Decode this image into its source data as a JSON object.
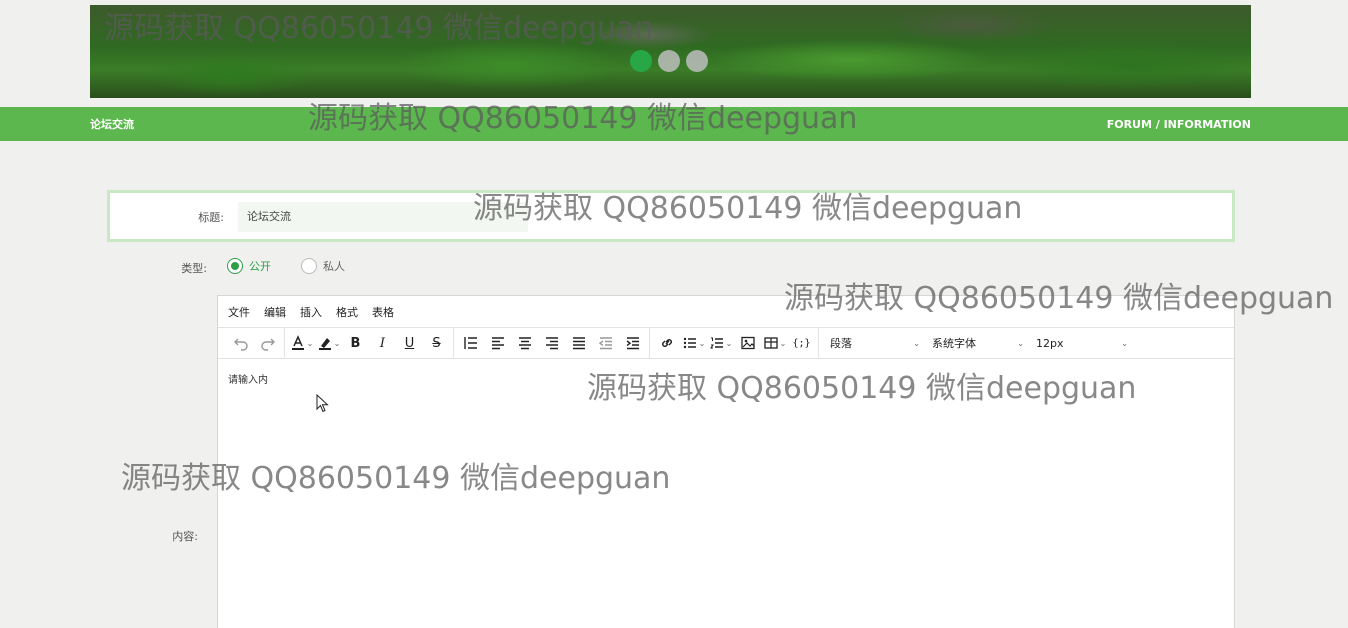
{
  "banner": {
    "slides": 3,
    "active_slide": 1
  },
  "nav": {
    "left_title": "论坛交流",
    "right_title": "FORUM / INFORMATION"
  },
  "form": {
    "title_label": "标题:",
    "title_value": "论坛交流",
    "type_label": "类型:",
    "type_options": [
      {
        "label": "公开",
        "checked": true
      },
      {
        "label": "私人",
        "checked": false
      }
    ],
    "content_label": "内容:"
  },
  "editor": {
    "menus": [
      "文件",
      "编辑",
      "插入",
      "格式",
      "表格"
    ],
    "block_format": "段落",
    "font_family": "系统字体",
    "font_size": "12px",
    "placeholder": "请输入内"
  },
  "watermark": "源码获取 QQ86050149 微信deepguan"
}
